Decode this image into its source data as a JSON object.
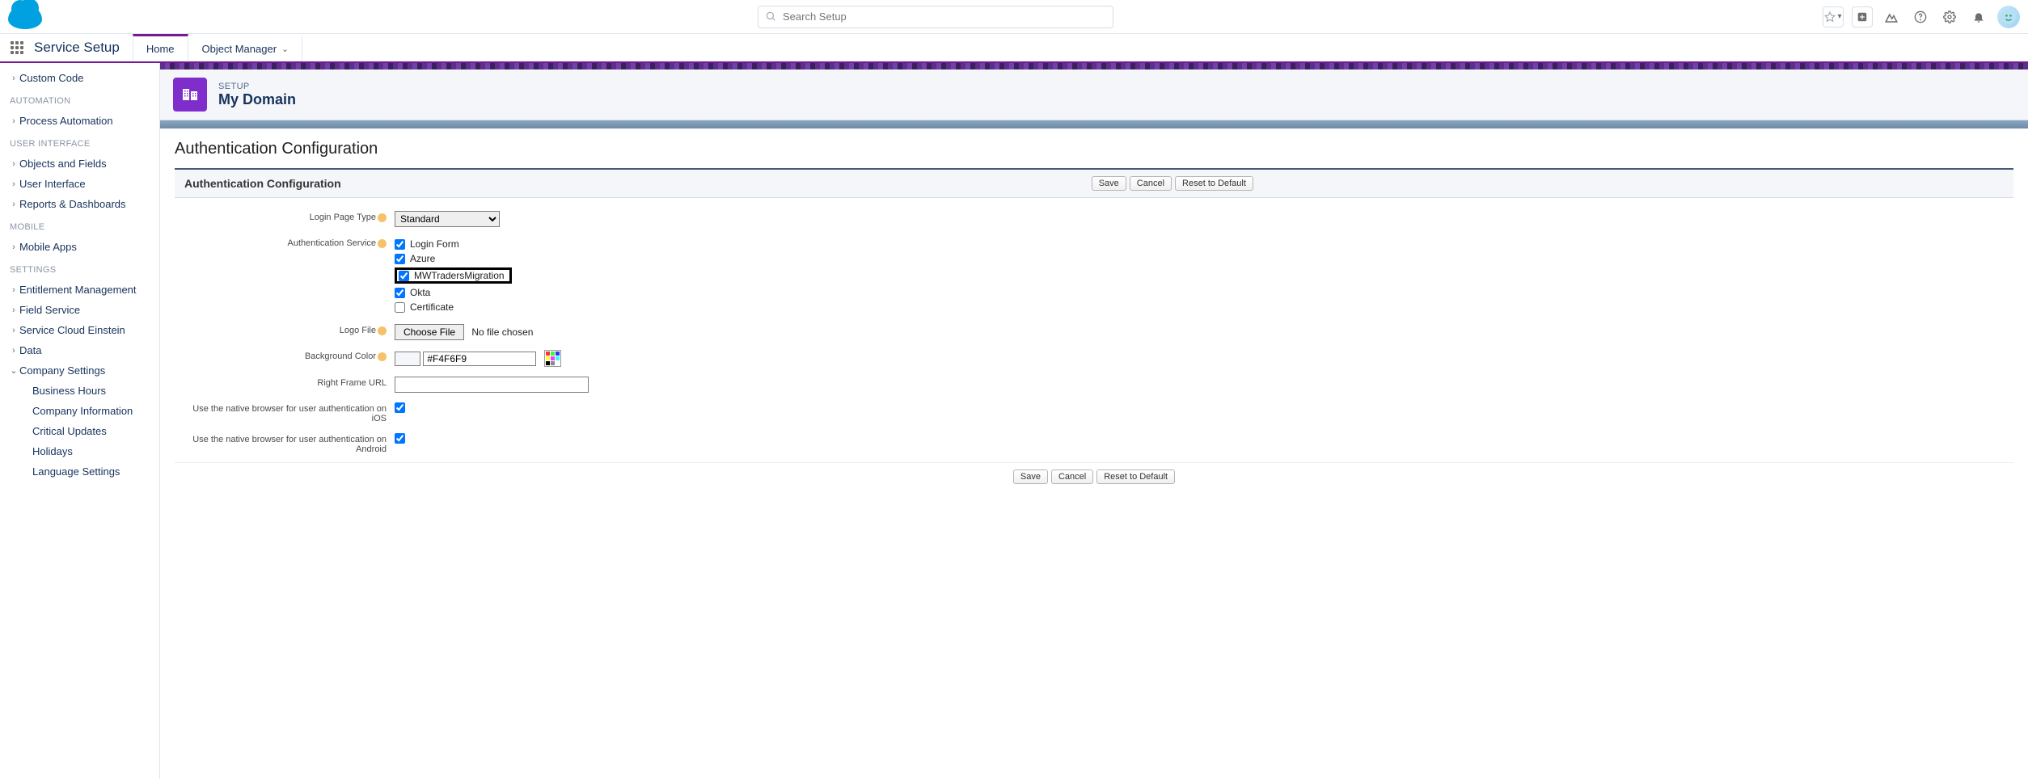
{
  "top": {
    "search_placeholder": "Search Setup"
  },
  "nav": {
    "app_name": "Service Setup",
    "tab_home": "Home",
    "tab_object_manager": "Object Manager"
  },
  "sidebar": {
    "items": [
      {
        "type": "item",
        "label": "Custom Code",
        "expandable": true
      },
      {
        "type": "group",
        "label": "AUTOMATION"
      },
      {
        "type": "item",
        "label": "Process Automation",
        "expandable": true
      },
      {
        "type": "group",
        "label": "USER INTERFACE"
      },
      {
        "type": "item",
        "label": "Objects and Fields",
        "expandable": true
      },
      {
        "type": "item",
        "label": "User Interface",
        "expandable": true
      },
      {
        "type": "item",
        "label": "Reports & Dashboards",
        "expandable": true
      },
      {
        "type": "group",
        "label": "MOBILE"
      },
      {
        "type": "item",
        "label": "Mobile Apps",
        "expandable": true
      },
      {
        "type": "group",
        "label": "SETTINGS"
      },
      {
        "type": "item",
        "label": "Entitlement Management",
        "expandable": true
      },
      {
        "type": "item",
        "label": "Field Service",
        "expandable": true
      },
      {
        "type": "item",
        "label": "Service Cloud Einstein",
        "expandable": true
      },
      {
        "type": "item",
        "label": "Data",
        "expandable": true
      },
      {
        "type": "item",
        "label": "Company Settings",
        "expandable": true,
        "expanded": true
      },
      {
        "type": "child",
        "label": "Business Hours"
      },
      {
        "type": "child",
        "label": "Company Information"
      },
      {
        "type": "child",
        "label": "Critical Updates"
      },
      {
        "type": "child",
        "label": "Holidays"
      },
      {
        "type": "child",
        "label": "Language Settings"
      }
    ]
  },
  "header": {
    "eyebrow": "SETUP",
    "title": "My Domain"
  },
  "page": {
    "title": "Authentication Configuration",
    "section_title": "Authentication Configuration",
    "buttons": {
      "save": "Save",
      "cancel": "Cancel",
      "reset": "Reset to Default"
    },
    "labels": {
      "login_page_type": "Login Page Type",
      "authentication_service": "Authentication Service",
      "logo_file": "Logo File",
      "background_color": "Background Color",
      "right_frame_url": "Right Frame URL",
      "native_ios": "Use the native browser for user authentication on iOS",
      "native_android": "Use the native browser for user authentication on Android"
    },
    "login_page_type_value": "Standard",
    "auth_services": [
      {
        "label": "Login Form",
        "checked": true
      },
      {
        "label": "Azure",
        "checked": true
      },
      {
        "label": "MWTradersMigration",
        "checked": true,
        "highlighted": true
      },
      {
        "label": "Okta",
        "checked": true
      },
      {
        "label": "Certificate",
        "checked": false
      }
    ],
    "file": {
      "choose_label": "Choose File",
      "no_file": "No file chosen"
    },
    "bg_color_value": "#F4F6F9",
    "right_frame_url_value": "",
    "native_ios_checked": true,
    "native_android_checked": true
  }
}
